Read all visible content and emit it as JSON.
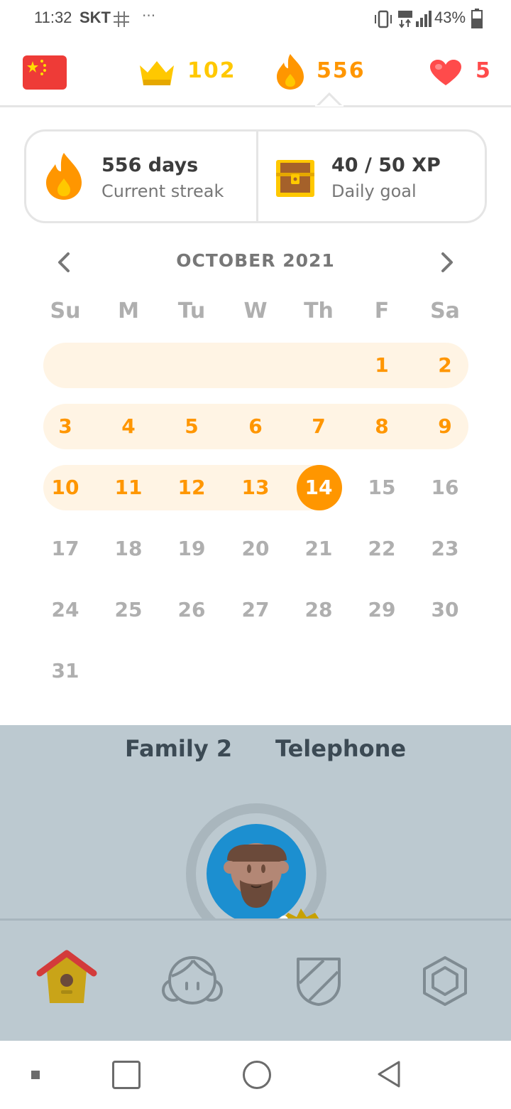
{
  "status_bar": {
    "time": "11:32",
    "carrier": "SKT",
    "battery": "43%"
  },
  "top_bar": {
    "course_flag": "china-flag-icon",
    "crowns": "102",
    "streak": "556",
    "hearts": "5",
    "colors": {
      "crown": "#ffc800",
      "streak": "#ff9600",
      "heart": "#ff4b4b"
    }
  },
  "summary": {
    "streak_title": "556 days",
    "streak_sub": "Current streak",
    "goal_title": "40 / 50 XP",
    "goal_sub": "Daily goal"
  },
  "calendar": {
    "month": "OCTOBER 2021",
    "weekdays": [
      "Su",
      "M",
      "Tu",
      "W",
      "Th",
      "F",
      "Sa"
    ],
    "today": "14",
    "weeks": [
      [
        "",
        "",
        "",
        "",
        "",
        "1",
        "2"
      ],
      [
        "3",
        "4",
        "5",
        "6",
        "7",
        "8",
        "9"
      ],
      [
        "10",
        "11",
        "12",
        "13",
        "14",
        "15",
        "16"
      ],
      [
        "17",
        "18",
        "19",
        "20",
        "21",
        "22",
        "23"
      ],
      [
        "24",
        "25",
        "26",
        "27",
        "28",
        "29",
        "30"
      ],
      [
        "31",
        "",
        "",
        "",
        "",
        "",
        ""
      ]
    ],
    "streak_days": [
      "1",
      "2",
      "3",
      "4",
      "5",
      "6",
      "7",
      "8",
      "9",
      "10",
      "11",
      "12",
      "13",
      "14"
    ]
  },
  "lessons": {
    "left_label": "Family 2",
    "right_label": "Telephone"
  },
  "tabs": [
    "home-icon",
    "characters-icon",
    "leagues-shield-icon",
    "shop-gem-icon"
  ]
}
